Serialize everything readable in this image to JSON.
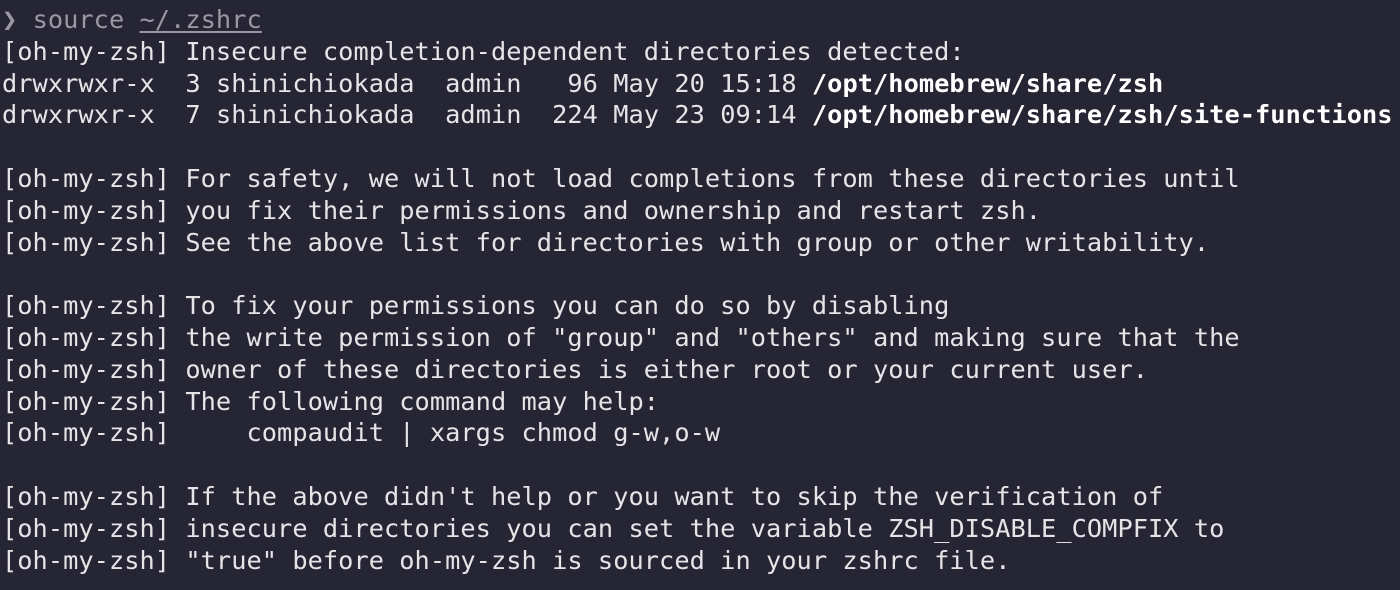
{
  "prompt": {
    "symbol": "❯",
    "command": "source",
    "argument": "~/.zshrc"
  },
  "warning_header": "[oh-my-zsh] Insecure completion-dependent directories detected:",
  "directory_listing": [
    {
      "permissions": "drwxrwxr-x",
      "links": "3",
      "owner": "shinichiokada",
      "group": "admin",
      "size": " 96",
      "date": "May 20 15:18",
      "path": "/opt/homebrew/share/zsh"
    },
    {
      "permissions": "drwxrwxr-x",
      "links": "7",
      "owner": "shinichiokada",
      "group": "admin",
      "size": "224",
      "date": "May 23 09:14",
      "path": "/opt/homebrew/share/zsh/site-functions"
    }
  ],
  "paragraphs": [
    [
      "[oh-my-zsh] For safety, we will not load completions from these directories until",
      "[oh-my-zsh] you fix their permissions and ownership and restart zsh.",
      "[oh-my-zsh] See the above list for directories with group or other writability."
    ],
    [
      "[oh-my-zsh] To fix your permissions you can do so by disabling",
      "[oh-my-zsh] the write permission of \"group\" and \"others\" and making sure that the",
      "[oh-my-zsh] owner of these directories is either root or your current user.",
      "[oh-my-zsh] The following command may help:",
      "[oh-my-zsh]     compaudit | xargs chmod g-w,o-w"
    ],
    [
      "[oh-my-zsh] If the above didn't help or you want to skip the verification of",
      "[oh-my-zsh] insecure directories you can set the variable ZSH_DISABLE_COMPFIX to",
      "[oh-my-zsh] \"true\" before oh-my-zsh is sourced in your zshrc file."
    ]
  ],
  "colors": {
    "background": "#262533",
    "foreground": "#e7e4e8",
    "prompt": "#9b98a4",
    "path": "#ffffff"
  }
}
